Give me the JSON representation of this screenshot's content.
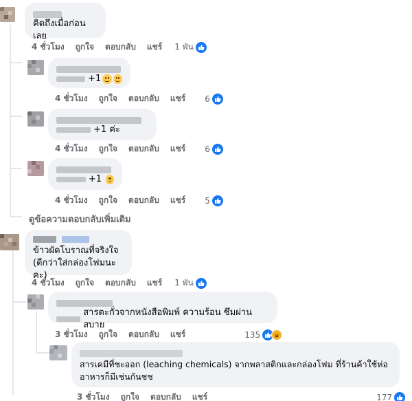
{
  "comments": [
    {
      "id": "c1",
      "text": "คิดถึงเมื่อก่อนเลย",
      "time": "4 ชั่วโมง",
      "like": "ถูกใจ",
      "reply": "ตอบกลับ",
      "share": "แชร์",
      "reactions": "1 พัน"
    },
    {
      "id": "r1",
      "text": "+1",
      "emoji": "grinning-face-emoji",
      "time": "4 ชั่วโมง",
      "like": "ถูกใจ",
      "reply": "ตอบกลับ",
      "share": "แชร์",
      "reactions": "6"
    },
    {
      "id": "r2",
      "text": "+1 ค่ะ",
      "time": "4 ชั่วโมง",
      "like": "ถูกใจ",
      "reply": "ตอบกลับ",
      "share": "แชร์",
      "reactions": "6"
    },
    {
      "id": "r3",
      "text": "+1",
      "emoji": "smiling-face-emoji",
      "time": "4 ชั่วโมง",
      "like": "ถูกใจ",
      "reply": "ตอบกลับ",
      "share": "แชร์",
      "reactions": "5"
    },
    {
      "id": "c2",
      "text_line1": "ข้าวผัดโบราณที่จริงใจ",
      "text_line2": "(ดีกว่าใส่กล่องโฟมนะคะ)",
      "time": "4 ชั่วโมง",
      "like": "ถูกใจ",
      "reply": "ตอบกลับ",
      "share": "แชร์",
      "reactions": "1 พัน"
    },
    {
      "id": "r4",
      "text": "สารตะกั่วจากหนังสือพิมพ์ ความร้อน ซึมผ่านสบาย",
      "time": "3 ชั่วโมง",
      "like": "ถูกใจ",
      "reply": "ตอบกลับ",
      "share": "แชร์",
      "reactions": "135"
    },
    {
      "id": "r5",
      "text_line1": "สารเคมีที่ชะออก (leaching chemicals) จากพลาสติกและกล่องโฟม ที่ร้านค้าใช้ห่อ",
      "text_line2": "อาหารก็มีเช่นกันชช",
      "time": "3 ชั่วโมง",
      "like": "ถูกใจ",
      "reply": "ตอบกลับ",
      "share": "แชร์",
      "reactions": "177"
    }
  ],
  "more_replies": "ดูข้อความตอบกลับเพิ่มเติม",
  "colors": {
    "bubble": "#f0f2f5",
    "meta_text": "#65676b",
    "like_blue": "#1877f2",
    "haha_yellow": "#f7b125"
  }
}
